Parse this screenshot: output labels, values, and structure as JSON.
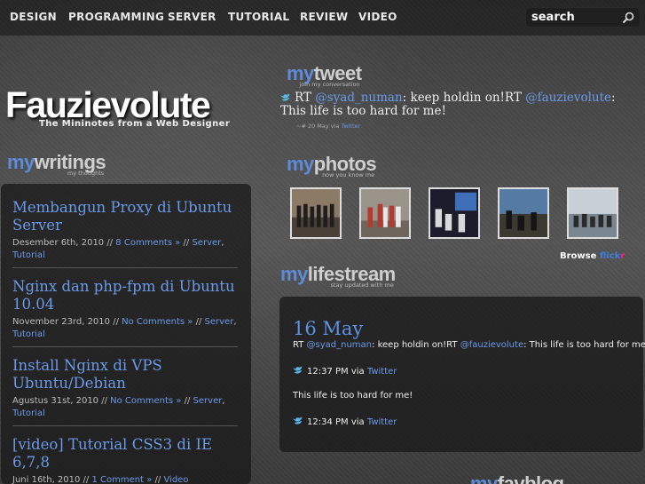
{
  "nav": {
    "items": [
      "DESIGN",
      "PROGRAMMING",
      "SERVER",
      "TUTORIAL",
      "REVIEW",
      "VIDEO"
    ]
  },
  "search": {
    "value": "search"
  },
  "logo": {
    "name": "Fauzievolute",
    "tagline": "The Mininotes from a Web Designer"
  },
  "writings": {
    "my": "my",
    "word": "writings",
    "sub": "my thoughts",
    "posts": [
      {
        "title": "Membangun Proxy di Ubuntu Server",
        "date": "Desember 6th, 2010",
        "comments": "8 Comments »",
        "categories": [
          "Server",
          "Tutorial"
        ]
      },
      {
        "title": "Nginx dan php-fpm di Ubuntu 10.04",
        "date": "November 23rd, 2010",
        "comments": "No Comments »",
        "categories": [
          "Server",
          "Tutorial"
        ]
      },
      {
        "title": "Install Nginx di VPS Ubuntu/Debian",
        "date": "Agustus 31st, 2010",
        "comments": "No Comments »",
        "categories": [
          "Server",
          "Tutorial"
        ]
      },
      {
        "title": "[video] Tutorial CSS3 di IE 6,7,8",
        "date": "Juni 16th, 2010",
        "comments": "1 Comment »",
        "categories": [
          "Video"
        ]
      }
    ]
  },
  "tweet": {
    "my": "my",
    "word": "tweet",
    "sub": "join my conversation",
    "prefix": "RT",
    "user1": "@syad_numan",
    "mid": ": keep holdin on!RT",
    "user2": "@fauzievolute",
    "text": ": This life is too hard for me!",
    "time": "~# 20 May via",
    "via": "Twitter"
  },
  "photos": {
    "my": "my",
    "word": "photos",
    "sub": "now you know me",
    "browse": "Browse",
    "flickr1": "flick",
    "flickr2": "r"
  },
  "lifestream": {
    "my": "my",
    "word": "lifestream",
    "sub": "stay updated with me",
    "date": "16 May",
    "entry1": {
      "prefix": "RT",
      "user1": "@syad_numan",
      "mid": ": keep holdin on!RT",
      "user2": "@fauzievolute",
      "text": ": This life is too hard for me!"
    },
    "time1": "12:37 PM via",
    "via1": "Twitter",
    "entry2": "This life is too hard for me!",
    "time2": "12:34 PM via",
    "via2": "Twitter"
  },
  "favblog": {
    "my": "my",
    "word": "favblog"
  },
  "colors": {
    "accent": "#5d8bd8",
    "link": "#6a9ae8",
    "heading": "#cfcfcf",
    "background": "#4a4a4a"
  }
}
